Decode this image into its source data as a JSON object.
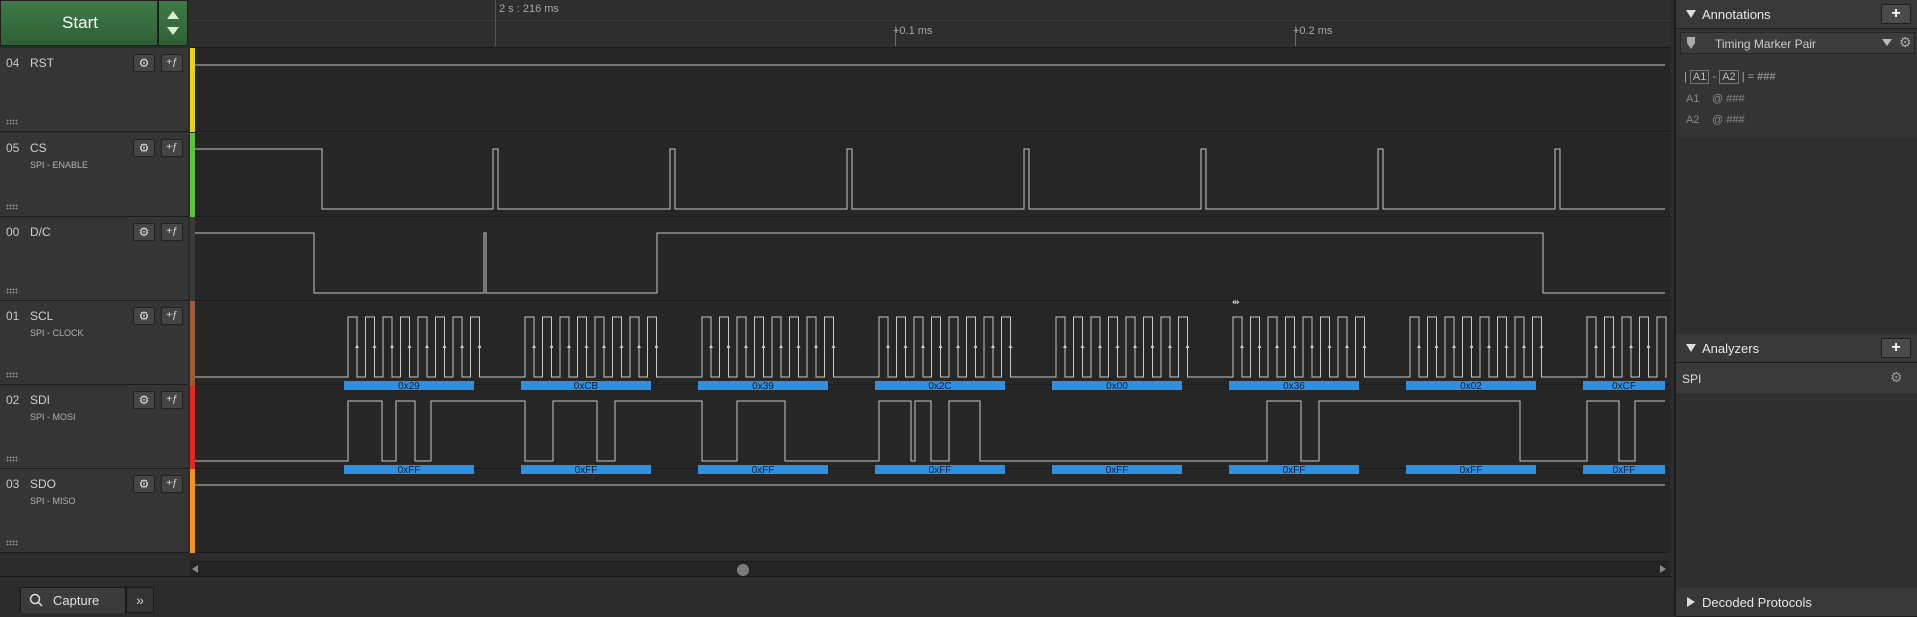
{
  "header": {
    "start_label": "Start"
  },
  "ruler": {
    "capture_time": "2 s : 216 ms",
    "tick1": "+0.1 ms",
    "tick2": "+0.2 ms"
  },
  "channels": [
    {
      "num": "04",
      "name": "RST",
      "sub": "",
      "color": "#e8d21c"
    },
    {
      "num": "05",
      "name": "CS",
      "sub": "SPI - ENABLE",
      "color": "#5fbf3f"
    },
    {
      "num": "00",
      "name": "D/C",
      "sub": "",
      "color": "#3a3a3a"
    },
    {
      "num": "01",
      "name": "SCL",
      "sub": "SPI - CLOCK",
      "color": "#9b5b3a"
    },
    {
      "num": "02",
      "name": "SDI",
      "sub": "SPI - MOSI",
      "color": "#e02828"
    },
    {
      "num": "03",
      "name": "SDO",
      "sub": "SPI - MISO",
      "color": "#f0941e"
    }
  ],
  "mosi_bytes": [
    "0x29",
    "0xCB",
    "0x39",
    "0x2C",
    "0x00",
    "0x36",
    "0x02",
    "0xCF"
  ],
  "miso_bytes": [
    "0xFF",
    "0xFF",
    "0xFF",
    "0xFF",
    "0xFF",
    "0xFF",
    "0xFF",
    "0xFF"
  ],
  "bottom": {
    "capture_tab": "Capture"
  },
  "annotations": {
    "title": "Annotations",
    "marker_select": "Timing Marker Pair",
    "formula_a1": "A1",
    "formula_dash": "-",
    "formula_a2": "A2",
    "formula_eq": "| = ###",
    "a1_label": "A1",
    "a1_value": "@   ###",
    "a2_label": "A2",
    "a2_value": "@   ###"
  },
  "analyzers": {
    "title": "Analyzers",
    "items": [
      "SPI"
    ]
  },
  "decoded": {
    "title": "Decoded Protocols"
  },
  "colors": {
    "decode_bar": "#2f8fe0",
    "wave": "#c8c8c8",
    "start_green": "#3f7b46"
  }
}
